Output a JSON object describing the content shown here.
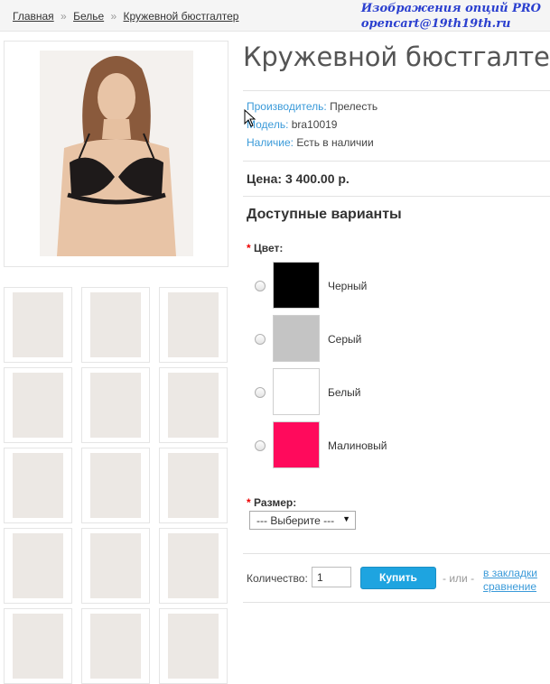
{
  "breadcrumb": {
    "items": [
      "Главная",
      "Белье",
      "Кружевной бюстгалтер"
    ],
    "separator": "»"
  },
  "watermark": {
    "line1": "Изображения опций PRO",
    "line2": "opencart@19th19th.ru"
  },
  "product": {
    "title": "Кружевной бюстгалтер",
    "manufacturer_label": "Производитель:",
    "manufacturer": "Прелесть",
    "model_label": "Модель:",
    "model": "bra10019",
    "availability_label": "Наличие:",
    "availability": "Есть в наличии",
    "price": "Цена: 3 400.00 р."
  },
  "options": {
    "title": "Доступные варианты",
    "color_label": "Цвет:",
    "colors": [
      {
        "name": "Черный",
        "hex": "#000000"
      },
      {
        "name": "Серый",
        "hex": "#c4c4c4"
      },
      {
        "name": "Белый",
        "hex": "#ffffff"
      },
      {
        "name": "Малиновый",
        "hex": "#ff0a5c"
      }
    ],
    "size_label": "Размер:",
    "size_selected": "--- Выберите ---"
  },
  "cart": {
    "qty_label": "Количество:",
    "qty": "1",
    "buy_label": "Купить",
    "or_label": "- или -",
    "wishlist_label": "в закладки",
    "compare_label": "сравнение"
  },
  "colors": {
    "link": "#3a9ad9",
    "button": "#1ea4e0",
    "watermark": "#2a3fcf"
  }
}
